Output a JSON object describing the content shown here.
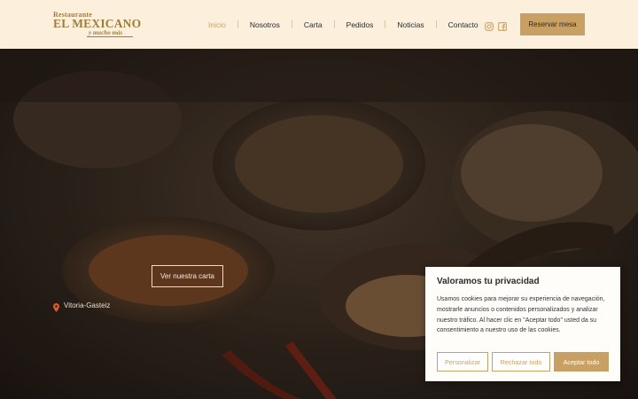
{
  "logo": {
    "top": "Restaurante",
    "main": "EL MEXICANO",
    "sub": "y mucho más"
  },
  "nav": {
    "items": [
      {
        "label": "Inicio",
        "active": true
      },
      {
        "label": "Nosotros"
      },
      {
        "label": "Carta"
      },
      {
        "label": "Pedidos"
      },
      {
        "label": "Noticias"
      },
      {
        "label": "Contacto"
      }
    ]
  },
  "social": {
    "icons": [
      "instagram-icon",
      "facebook-icon"
    ]
  },
  "header": {
    "reserve_label": "Reservar mesa"
  },
  "hero": {
    "cta_label": "Ver nuestra carta",
    "location": "Vitoria-Gasteiz"
  },
  "cookie": {
    "title": "Valoramos tu privacidad",
    "text": "Usamos cookies para mejorar su experiencia de navegación, mostrarle anuncios o contenidos personalizados y analizar nuestro tráfico. Al hacer clic en \"Aceptar todo\" usted da su consentimiento a nuestro uso de las cookies.",
    "customize_label": "Personalizar",
    "reject_label": "Rechazar todo",
    "accept_label": "Aceptar todo"
  },
  "colors": {
    "accent": "#c9a063",
    "header_bg": "#fcf0dc",
    "pin": "#e05a2a"
  }
}
